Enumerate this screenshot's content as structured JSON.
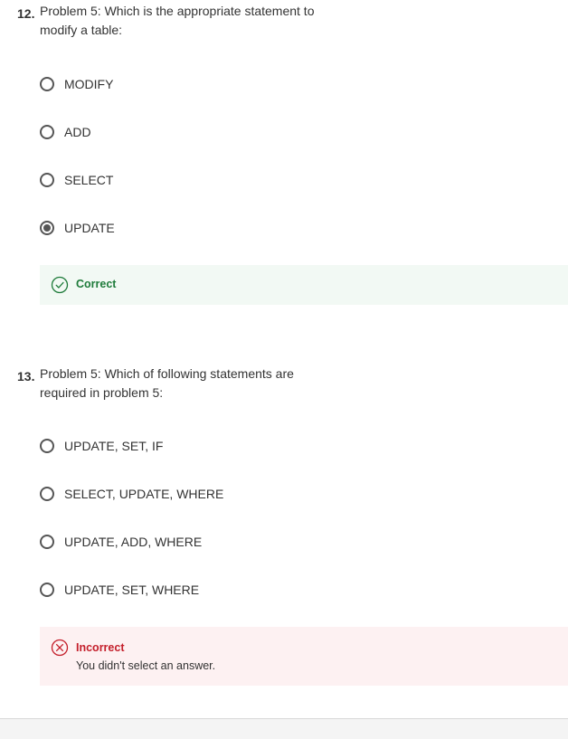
{
  "questions": [
    {
      "number": "12.",
      "text": "Problem 5: Which is the appropriate statement to modify a table:",
      "options": [
        {
          "label": "MODIFY",
          "selected": false
        },
        {
          "label": "ADD",
          "selected": false
        },
        {
          "label": "SELECT",
          "selected": false
        },
        {
          "label": "UPDATE",
          "selected": true
        }
      ],
      "feedback": {
        "status": "correct",
        "title": "Correct",
        "icon": "check-circle-icon",
        "detail": ""
      }
    },
    {
      "number": "13.",
      "text": "Problem 5: Which of following statements are required in problem 5:",
      "options": [
        {
          "label": "UPDATE, SET, IF",
          "selected": false
        },
        {
          "label": "SELECT, UPDATE, WHERE",
          "selected": false
        },
        {
          "label": "UPDATE, ADD, WHERE",
          "selected": false
        },
        {
          "label": "UPDATE, SET, WHERE",
          "selected": false
        }
      ],
      "feedback": {
        "status": "incorrect",
        "title": "Incorrect",
        "icon": "x-circle-icon",
        "detail": "You didn't select an answer."
      }
    }
  ],
  "colors": {
    "correct": "#1e7b3a",
    "correct_bg": "#f2f9f4",
    "incorrect": "#c41f2b",
    "incorrect_bg": "#fdf1f2",
    "radio_border": "#555555"
  }
}
